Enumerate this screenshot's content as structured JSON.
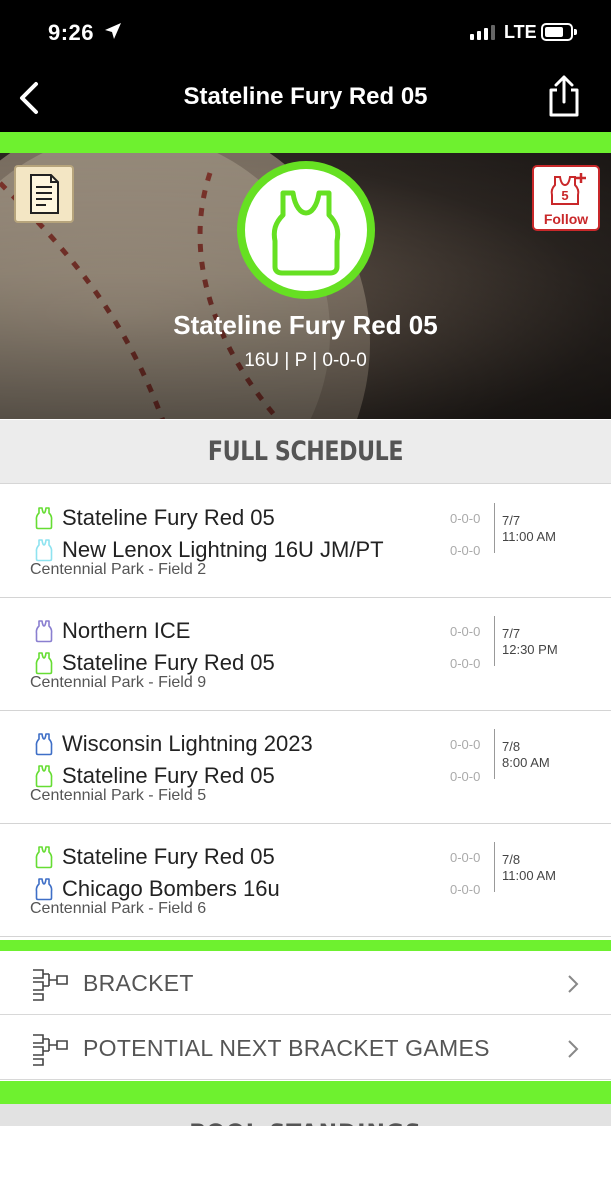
{
  "status": {
    "time": "9:26",
    "network": "LTE"
  },
  "nav": {
    "title": "Stateline Fury Red 05"
  },
  "hero": {
    "team_name": "Stateline Fury Red 05",
    "subtitle": "16U | P | 0-0-0",
    "follow_label": "Follow"
  },
  "schedule": {
    "header": "FULL SCHEDULE",
    "games": [
      {
        "team1": {
          "name": "Stateline Fury Red 05",
          "record": "0-0-0",
          "icon_color": "#66dd33"
        },
        "team2": {
          "name": "New Lenox Lightning 16U JM/PT",
          "record": "0-0-0",
          "icon_color": "#8fe3f0"
        },
        "date": "7/7",
        "time": "11:00 AM",
        "venue": "Centennial Park - Field 2"
      },
      {
        "team1": {
          "name": "Northern ICE",
          "record": "0-0-0",
          "icon_color": "#8a7fd0"
        },
        "team2": {
          "name": "Stateline Fury Red 05",
          "record": "0-0-0",
          "icon_color": "#66dd33"
        },
        "date": "7/7",
        "time": "12:30 PM",
        "venue": "Centennial Park - Field 9"
      },
      {
        "team1": {
          "name": "Wisconsin Lightning 2023",
          "record": "0-0-0",
          "icon_color": "#3f6fc7"
        },
        "team2": {
          "name": "Stateline Fury Red 05",
          "record": "0-0-0",
          "icon_color": "#66dd33"
        },
        "date": "7/8",
        "time": "8:00 AM",
        "venue": "Centennial Park - Field 5"
      },
      {
        "team1": {
          "name": "Stateline Fury Red 05",
          "record": "0-0-0",
          "icon_color": "#66dd33"
        },
        "team2": {
          "name": "Chicago Bombers 16u",
          "record": "0-0-0",
          "icon_color": "#3f6fc7"
        },
        "date": "7/8",
        "time": "11:00 AM",
        "venue": "Centennial Park - Field 6"
      }
    ]
  },
  "links": [
    {
      "label": "BRACKET"
    },
    {
      "label": "POTENTIAL NEXT BRACKET GAMES"
    }
  ],
  "pool": {
    "label": "POOL STANDINGS"
  },
  "colors": {
    "accent_green": "#6ef12f",
    "follow_red": "#c9282a",
    "logo_green": "#66e022"
  }
}
